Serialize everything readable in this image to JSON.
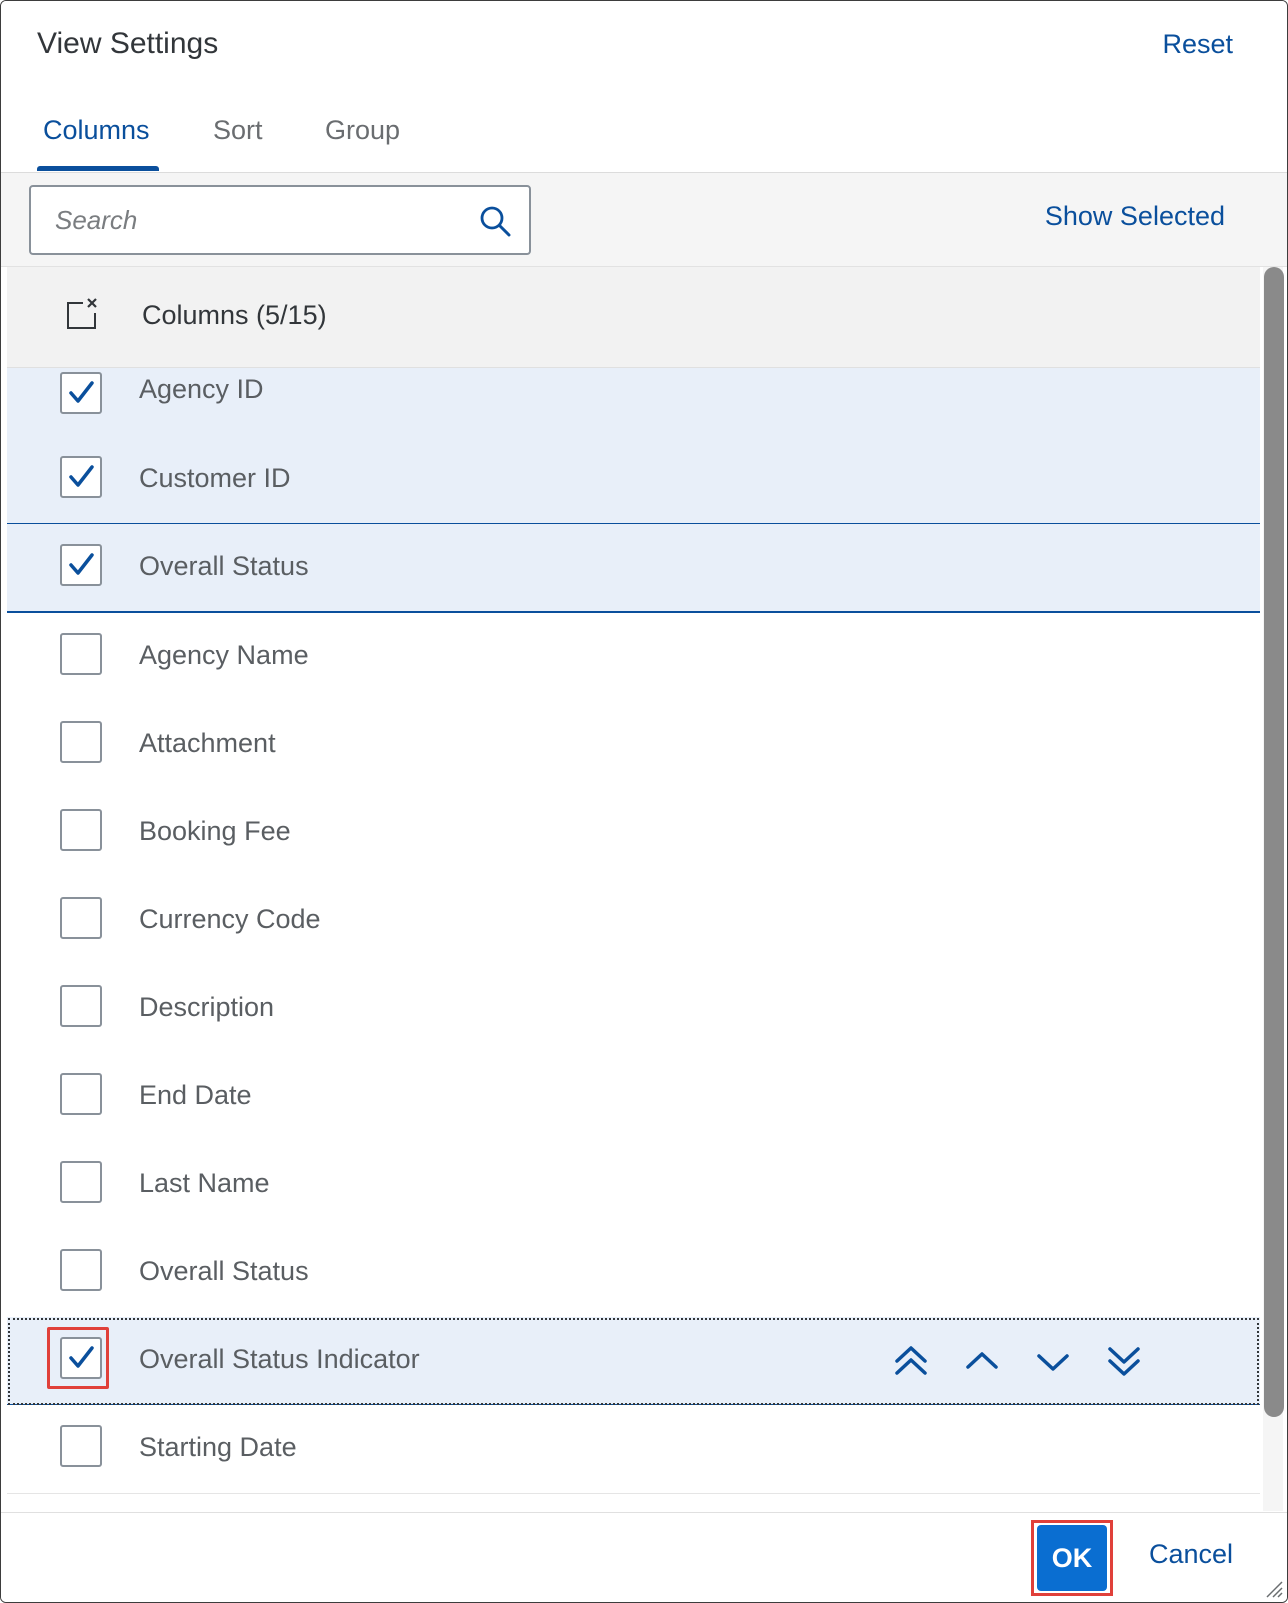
{
  "dialog": {
    "title": "View Settings",
    "reset_label": "Reset"
  },
  "tabs": [
    {
      "label": "Columns",
      "active": true
    },
    {
      "label": "Sort",
      "active": false
    },
    {
      "label": "Group",
      "active": false
    }
  ],
  "toolbar": {
    "search_placeholder": "Search",
    "search_icon": "search-icon",
    "show_selected_label": "Show Selected"
  },
  "list": {
    "header_label": "Columns (5/15)",
    "header_icon": "deselect-all-icon",
    "rows": [
      {
        "label": "Agency ID",
        "checked": true
      },
      {
        "label": "Customer ID",
        "checked": true
      },
      {
        "label": "Overall Status",
        "checked": true
      },
      {
        "label": "Agency Name",
        "checked": false
      },
      {
        "label": "Attachment",
        "checked": false
      },
      {
        "label": "Booking Fee",
        "checked": false
      },
      {
        "label": "Currency Code",
        "checked": false
      },
      {
        "label": "Description",
        "checked": false
      },
      {
        "label": "End Date",
        "checked": false
      },
      {
        "label": "Last Name",
        "checked": false
      },
      {
        "label": "Overall Status",
        "checked": false
      },
      {
        "label": "Overall Status Indicator",
        "checked": true,
        "focused": true
      },
      {
        "label": "Starting Date",
        "checked": false
      }
    ],
    "move_buttons": [
      "move-to-top-icon",
      "move-up-icon",
      "move-down-icon",
      "move-to-bottom-icon"
    ]
  },
  "footer": {
    "ok_label": "OK",
    "cancel_label": "Cancel"
  },
  "colors": {
    "accent": "#0a4f9c",
    "selected_row": "#e8eff9",
    "emphasized_button": "#0a6ed1",
    "highlight_frame": "#e0403a"
  }
}
